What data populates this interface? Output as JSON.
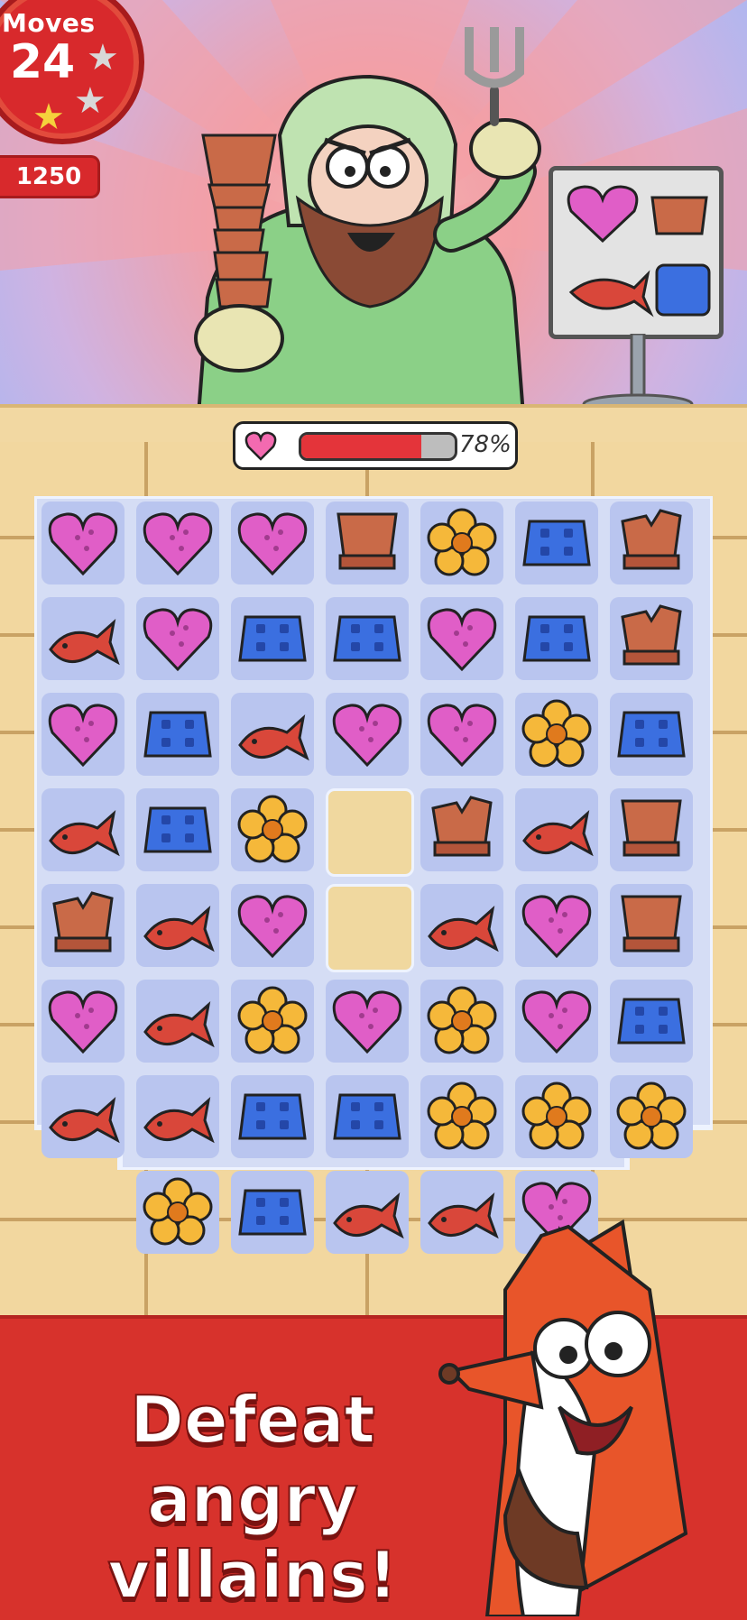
{
  "hud": {
    "moves_label": "Moves",
    "moves_value": "24",
    "score": "1250",
    "stars_earned": 1,
    "stars_total": 3
  },
  "enemy": {
    "health_icon": "heart-icon",
    "health_percent_text": "78%",
    "health_percent": 78
  },
  "recipe_board": {
    "pieces": [
      "heart",
      "pot",
      "fish",
      "sponge"
    ]
  },
  "board": {
    "rows": [
      [
        "heart",
        "heart",
        "heart",
        "pot",
        "flower",
        "sponge",
        "brokenpot"
      ],
      [
        "fish",
        "heart",
        "sponge",
        "sponge",
        "heart",
        "sponge",
        "brokenpot"
      ],
      [
        "heart",
        "sponge",
        "fish",
        "heart",
        "heart",
        "flower",
        "sponge"
      ],
      [
        "fish",
        "sponge",
        "flower",
        "empty",
        "brokenpot",
        "fish",
        "pot"
      ],
      [
        "brokenpot",
        "fish",
        "heart",
        "empty",
        "fish",
        "heart",
        "pot"
      ],
      [
        "heart",
        "fish",
        "flower",
        "heart",
        "flower",
        "heart",
        "sponge"
      ],
      [
        "fish",
        "fish",
        "sponge",
        "sponge",
        "flower",
        "flower",
        "flower"
      ],
      [
        "none",
        "flower",
        "sponge",
        "fish",
        "fish",
        "heart",
        "none"
      ]
    ]
  },
  "promo": {
    "line1": "Defeat",
    "line2": "angry villains!"
  },
  "colors": {
    "banner_red": "#d7322c",
    "heart": "#e05ec7",
    "sponge": "#3b6fe0",
    "fish": "#d9473a",
    "flower": "#f5b83a",
    "pot": "#c96a48",
    "hp_fill": "#e4343a"
  }
}
